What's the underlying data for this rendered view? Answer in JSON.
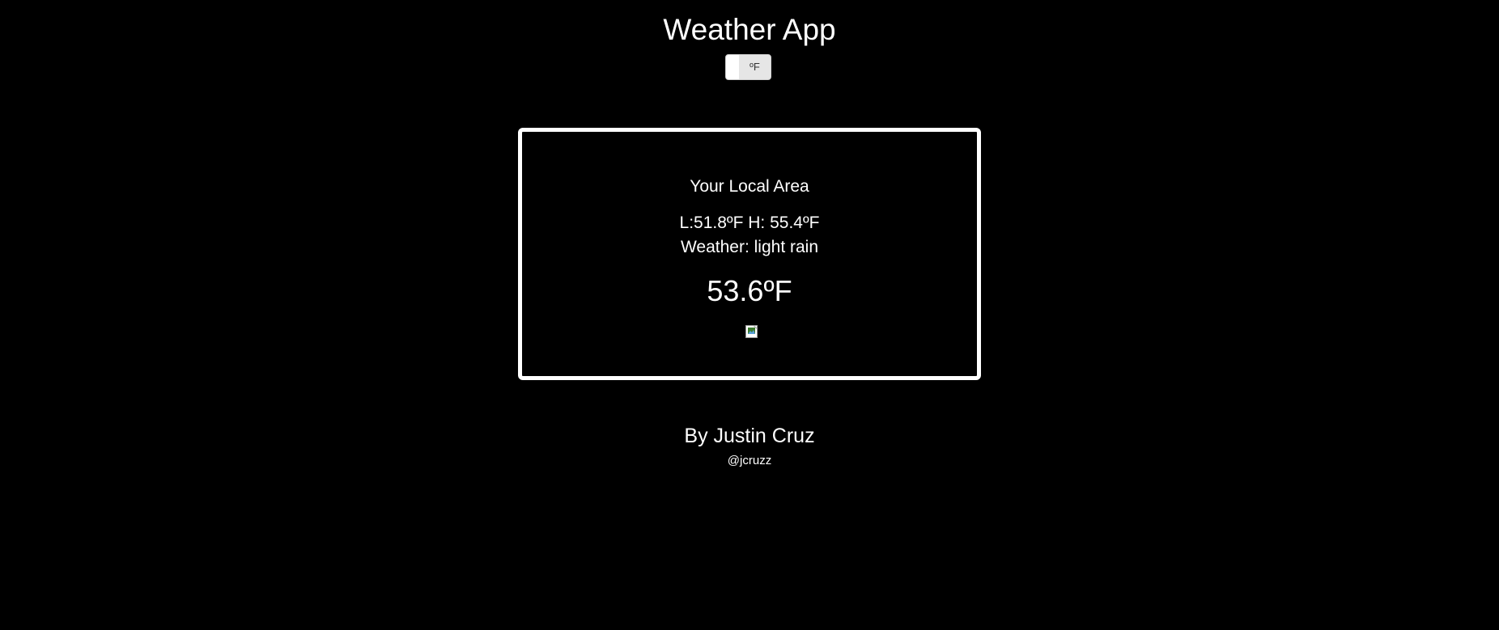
{
  "header": {
    "title": "Weather App",
    "unit_toggle_label": "ºF"
  },
  "card": {
    "location": "Your Local Area",
    "range": "L:51.8ºF H: 55.4ºF",
    "condition": "Weather: light rain",
    "temperature": "53.6ºF",
    "icon": "broken-image-icon"
  },
  "footer": {
    "author": "By Justin Cruz",
    "handle": "@jcruzz"
  },
  "colors": {
    "background": "#000000",
    "text": "#ffffff",
    "toggle": "#e6e6e6"
  }
}
